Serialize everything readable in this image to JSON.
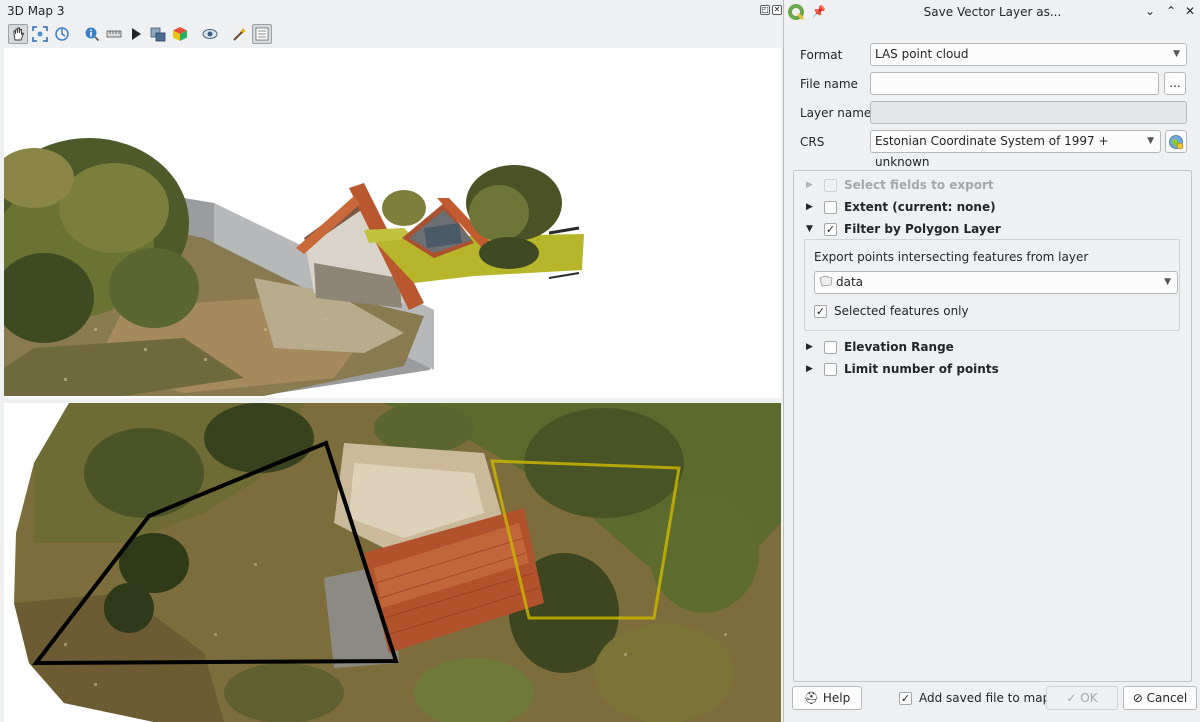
{
  "map3d": {
    "title": "3D Map 3",
    "toolbar": [
      {
        "name": "pan-icon",
        "active": true
      },
      {
        "name": "zoom-full-icon"
      },
      {
        "name": "camera-control-icon"
      },
      {
        "name": "identify-icon"
      },
      {
        "name": "measure-line-icon"
      },
      {
        "name": "play-animation-icon"
      },
      {
        "name": "save-image-icon"
      },
      {
        "name": "export-3d-scene-icon"
      },
      {
        "name": "camera-view-icon"
      },
      {
        "name": "effects-icon"
      },
      {
        "name": "configure-icon",
        "active": true
      }
    ]
  },
  "dialog": {
    "title": "Save Vector Layer as...",
    "format_label": "Format",
    "format_value": "LAS point cloud",
    "filename_label": "File name",
    "filename_value": "",
    "browse_label": "...",
    "layername_label": "Layer name",
    "layername_value": "",
    "crs_label": "CRS",
    "crs_value": "Estonian Coordinate System of 1997 + unknown",
    "groups": {
      "select_fields": {
        "label": "Select fields to export",
        "checked": false,
        "enabled": false,
        "expanded": false
      },
      "extent": {
        "label": "Extent (current: none)",
        "checked": false,
        "enabled": true,
        "expanded": false
      },
      "filter_polygon": {
        "label": "Filter by Polygon Layer",
        "checked": true,
        "enabled": true,
        "expanded": true
      },
      "elevation": {
        "label": "Elevation Range",
        "checked": false,
        "enabled": true,
        "expanded": false
      },
      "limit_points": {
        "label": "Limit number of points",
        "checked": false,
        "enabled": true,
        "expanded": false
      }
    },
    "filter": {
      "description": "Export points intersecting features from layer",
      "layer_value": "data",
      "selected_only_label": "Selected features only",
      "selected_only_checked": true
    },
    "help_label": "Help",
    "add_to_map_label": "Add saved file to map",
    "add_to_map_checked": true,
    "ok_label": "OK",
    "cancel_label": "Cancel"
  },
  "colors": {
    "polygon_selected": "#000000",
    "polygon_other": "#c8b400",
    "panel_bg": "#eff0f1"
  }
}
